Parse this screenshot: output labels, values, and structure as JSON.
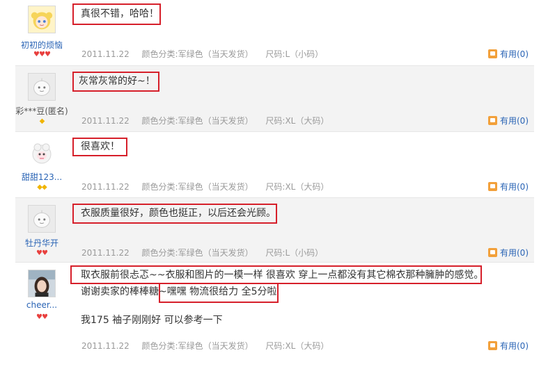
{
  "reviews": [
    {
      "user": "初初的烦恼",
      "avatar": "anime-girl-avatar",
      "rank": "hearts-3",
      "lines": [
        "真很不错，哈哈！"
      ],
      "date": "2011.11.22",
      "color": "颜色分类:军绿色（当天发货）",
      "size": "尺码:L（小码）",
      "useful": "有用(0)"
    },
    {
      "user": "彩***豆(匿名)",
      "avatar": "default-avatar",
      "rank": "diamond-1",
      "lines": [
        "灰常灰常的好~！"
      ],
      "date": "2011.11.22",
      "color": "颜色分类:军绿色（当天发货）",
      "size": "尺码:XL（大码）",
      "useful": "有用(0)"
    },
    {
      "user": "甜甜123...",
      "avatar": "sheep-avatar",
      "rank": "diamond-2",
      "lines": [
        "很喜欢！"
      ],
      "date": "2011.11.22",
      "color": "颜色分类:军绿色（当天发货）",
      "size": "尺码:XL（大码）",
      "useful": "有用(0)"
    },
    {
      "user": "牡丹华开",
      "avatar": "default-avatar",
      "rank": "hearts-2",
      "lines": [
        "衣服质量很好，颜色也挺正，以后还会光顾。"
      ],
      "date": "2011.11.22",
      "color": "颜色分类:军绿色（当天发货）",
      "size": "尺码:L（小码）",
      "useful": "有用(0)"
    },
    {
      "user": "cheer...",
      "avatar": "photo-avatar",
      "rank": "hearts-2",
      "lines": [
        "取衣服前很忐忑~~衣服和图片的一模一样 很喜欢 穿上一点都没有其它棉衣那种臃肿的感觉。",
        "谢谢卖家的棒棒糖~嘿嘿 物流很给力 全5分啦",
        "我175 袖子刚刚好 可以参考一下"
      ],
      "date": "2011.11.22",
      "color": "颜色分类:军绿色（当天发货）",
      "size": "尺码:XL（大码）",
      "useful": "有用(0)"
    }
  ],
  "colors": {
    "highlight_box": "#d61f2a",
    "link": "#2a64b5",
    "meta": "#9a9a9a",
    "heart": "#e8403e",
    "diamond": "#f0b400",
    "alt_row": "#f3f3f3"
  }
}
